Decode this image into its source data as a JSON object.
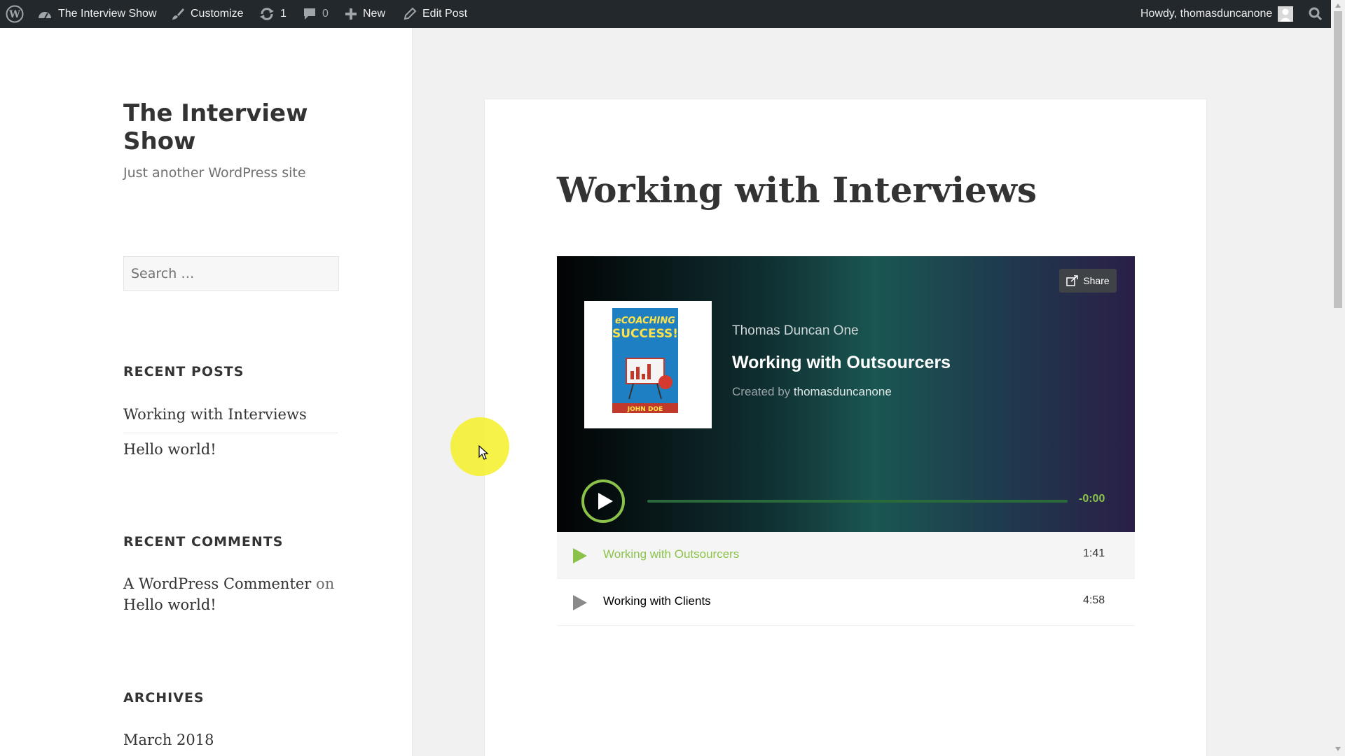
{
  "adminbar": {
    "site_name": "The Interview Show",
    "customize": "Customize",
    "updates_count": "1",
    "comments_count": "0",
    "new": "New",
    "edit_post": "Edit Post",
    "howdy": "Howdy, thomasduncanone"
  },
  "sidebar": {
    "site_title": "The Interview Show",
    "tagline": "Just another WordPress site",
    "search_placeholder": "Search …",
    "recent_posts": {
      "title": "RECENT POSTS",
      "items": [
        "Working with Interviews",
        "Hello world!"
      ]
    },
    "recent_comments": {
      "title": "RECENT COMMENTS",
      "author": "A WordPress Commenter",
      "on": "on",
      "post": "Hello world!"
    },
    "archives": {
      "title": "ARCHIVES",
      "items": [
        "March 2018"
      ]
    }
  },
  "article": {
    "title": "Working with Interviews",
    "player": {
      "share_label": "Share",
      "artist": "Thomas Duncan One",
      "track_title": "Working with Outsourcers",
      "created_by_label": "Created by",
      "created_by": "thomasduncanone",
      "time_remaining": "-0:00",
      "progress": 0,
      "accent_color": "#8bc34a",
      "cover_text": {
        "brand_top": "eCOACHING",
        "brand_bottom": "SUCCESS!",
        "author": "JOHN DOE"
      }
    },
    "tracks": [
      {
        "name": "Working with Outsourcers",
        "duration": "1:41",
        "active": true
      },
      {
        "name": "Working with Clients",
        "duration": "4:58",
        "active": false
      }
    ]
  }
}
